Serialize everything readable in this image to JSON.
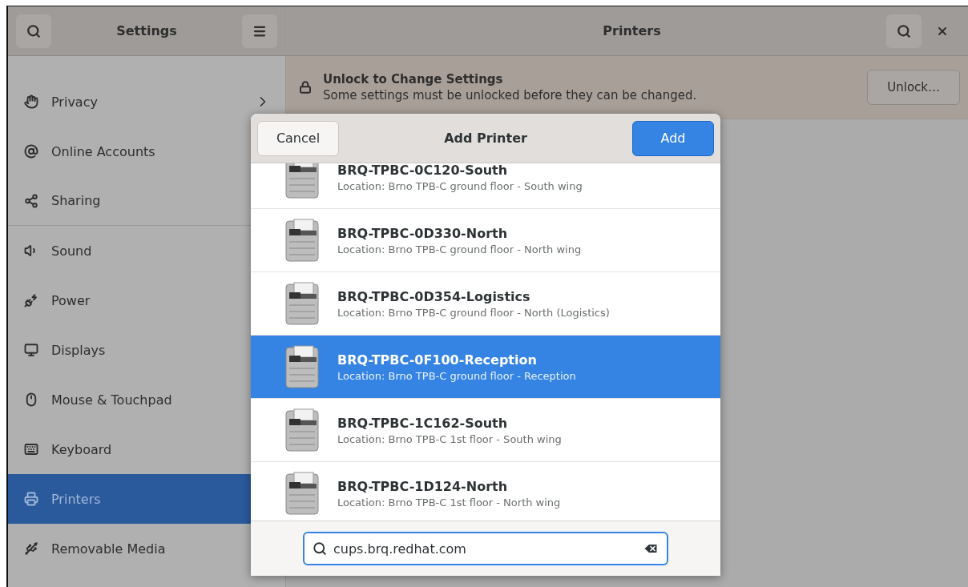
{
  "window": {
    "sidebar_title": "Settings",
    "title": "Printers"
  },
  "sidebar": {
    "items": [
      {
        "label": "Privacy",
        "chevron": true,
        "divider_after": false,
        "selected": false
      },
      {
        "label": "Online Accounts",
        "divider_after": false,
        "selected": false
      },
      {
        "label": "Sharing",
        "divider_after": true,
        "selected": false
      },
      {
        "label": "Sound",
        "divider_after": false,
        "selected": false
      },
      {
        "label": "Power",
        "divider_after": false,
        "selected": false
      },
      {
        "label": "Displays",
        "divider_after": false,
        "selected": false
      },
      {
        "label": "Mouse & Touchpad",
        "divider_after": false,
        "selected": false
      },
      {
        "label": "Keyboard",
        "divider_after": false,
        "selected": false
      },
      {
        "label": "Printers",
        "divider_after": false,
        "selected": true
      },
      {
        "label": "Removable Media",
        "divider_after": false,
        "selected": false
      }
    ]
  },
  "banner": {
    "title": "Unlock to Change Settings",
    "text": "Some settings must be unlocked before they can be changed.",
    "button": "Unlock…"
  },
  "dialog": {
    "title": "Add Printer",
    "cancel": "Cancel",
    "confirm": "Add",
    "printers": [
      {
        "name": "BRQ-TPBC-0C120-South",
        "location": "Location: Brno TPB-C ground floor - South wing",
        "selected": false
      },
      {
        "name": "BRQ-TPBC-0D330-North",
        "location": "Location: Brno TPB-C ground floor - North wing",
        "selected": false
      },
      {
        "name": "BRQ-TPBC-0D354-Logistics",
        "location": "Location: Brno TPB-C ground floor - North (Logistics)",
        "selected": false
      },
      {
        "name": "BRQ-TPBC-0F100-Reception",
        "location": "Location: Brno TPB-C ground floor - Reception",
        "selected": true
      },
      {
        "name": "BRQ-TPBC-1C162-South",
        "location": "Location: Brno TPB-C 1st floor - South wing",
        "selected": false
      },
      {
        "name": "BRQ-TPBC-1D124-North",
        "location": "Location: Brno TPB-C 1st floor - North wing",
        "selected": false
      }
    ],
    "search": {
      "value": "cups.brq.redhat.com"
    }
  }
}
